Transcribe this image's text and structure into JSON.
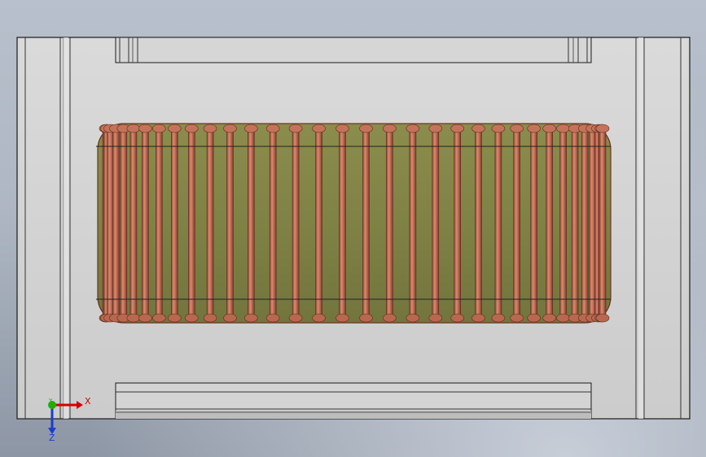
{
  "scene": {
    "description_label": "",
    "colors": {
      "housing": "#d2d2d2",
      "housing_edge": "#1a1a1a",
      "core": "#7e8146",
      "copper": "#bd6e55",
      "copper_dark": "#7a3a2a",
      "copper_light": "#e19a82"
    },
    "winding": {
      "turns_visible": 34
    }
  },
  "triad": {
    "x_label": "X",
    "y_label": "Y",
    "z_label": "Z",
    "x_color": "#d40000",
    "y_color": "#1cb000",
    "z_color": "#1a3ccf"
  }
}
